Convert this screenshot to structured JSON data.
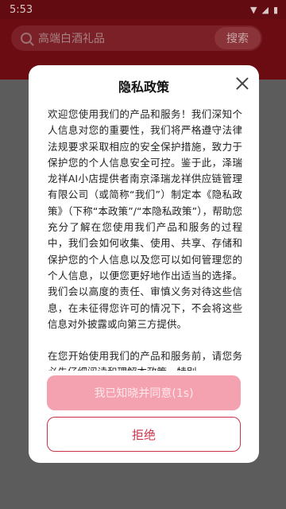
{
  "status_bar": {
    "time": "5:53"
  },
  "header": {
    "search_placeholder": "高端白酒礼品",
    "search_button": "搜索"
  },
  "dialog": {
    "title": "隐私政策",
    "paragraphs": [
      "欢迎您使用我们的产品和服务！我们深知个人信息对您的重要性，我们将严格遵守法律法规要求采取相应的安全保护措施，致力于保护您的个人信息安全可控。鉴于此，泽瑞龙祥AI小店提供者南京泽瑞龙祥供应链管理有限公司（或简称“我们”）制定本《隐私政策》（下称“本政策”/“本隐私政策”），帮助您充分了解在您使用我们产品和服务的过程中，我们会如何收集、使用、共享、存储和保护您的个人信息以及您可以如何管理您的个人信息，以便您更好地作出适当的选择。我们会以高度的责任、审慎义务对待这些信息，在未征得您许可的情况下，不会将这些信息对外披露或向第三方提供。",
      "在您开始使用我们的产品和服务前，请您务必先仔细阅读和理解本政策，特别"
    ],
    "agree_button": "我已知晓并同意(1s)",
    "reject_button": "拒绝"
  }
}
